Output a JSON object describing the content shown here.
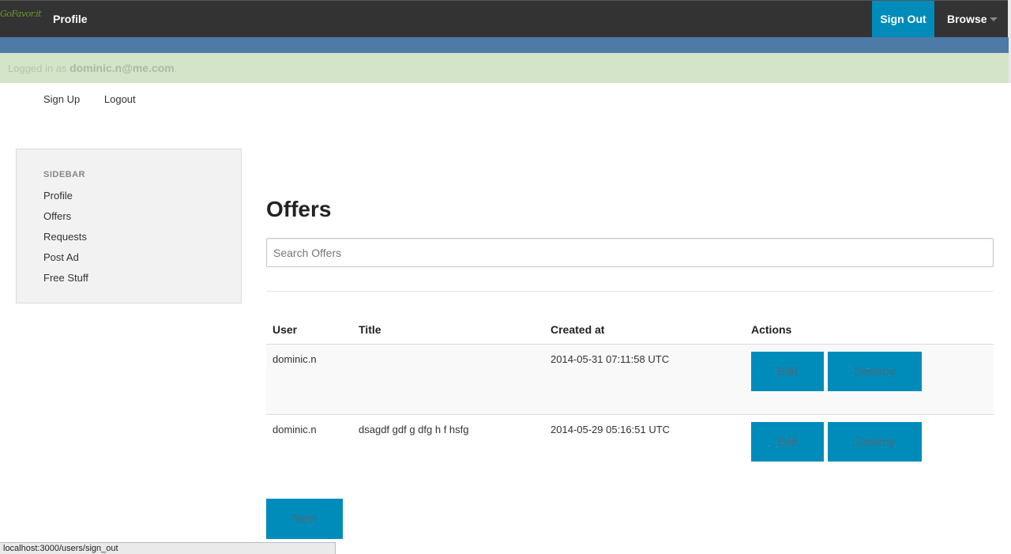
{
  "navbar": {
    "logo_text": "GoFavor.it",
    "profile_label": "Profile",
    "signout_label": "Sign Out",
    "browse_label": "Browse"
  },
  "notice": {
    "prefix": "Logged in as ",
    "email": "dominic.n@me.com",
    "suffix": "."
  },
  "sublinks": {
    "signup": "Sign Up",
    "logout": "Logout"
  },
  "sidebar": {
    "heading": "SIDEBAR",
    "items": [
      {
        "label": "Profile"
      },
      {
        "label": "Offers"
      },
      {
        "label": "Requests"
      },
      {
        "label": "Post Ad"
      },
      {
        "label": "Free Stuff"
      }
    ]
  },
  "main": {
    "title": "Offers",
    "search_placeholder": "Search Offers",
    "table": {
      "headers": [
        "User",
        "Title",
        "Created at",
        "Actions"
      ],
      "rows": [
        {
          "user": "dominic.n",
          "title": "",
          "created_at": "2014-05-31 07:11:58 UTC",
          "edit_label": "Edit",
          "destroy_label": "Destroy"
        },
        {
          "user": "dominic.n",
          "title": "dsagdf gdf g dfg h f hsfg",
          "created_at": "2014-05-29 05:16:51 UTC",
          "edit_label": "Edit",
          "destroy_label": "Destroy"
        }
      ]
    },
    "new_label": "New"
  },
  "statusbar": {
    "url": "localhost:3000/users/sign_out"
  },
  "colors": {
    "navbar": "#333333",
    "accent": "#008cba",
    "blue_band": "#4d7aa6",
    "notice_bg": "#d3e4c8",
    "sidebar_bg": "#f2f2f2"
  }
}
